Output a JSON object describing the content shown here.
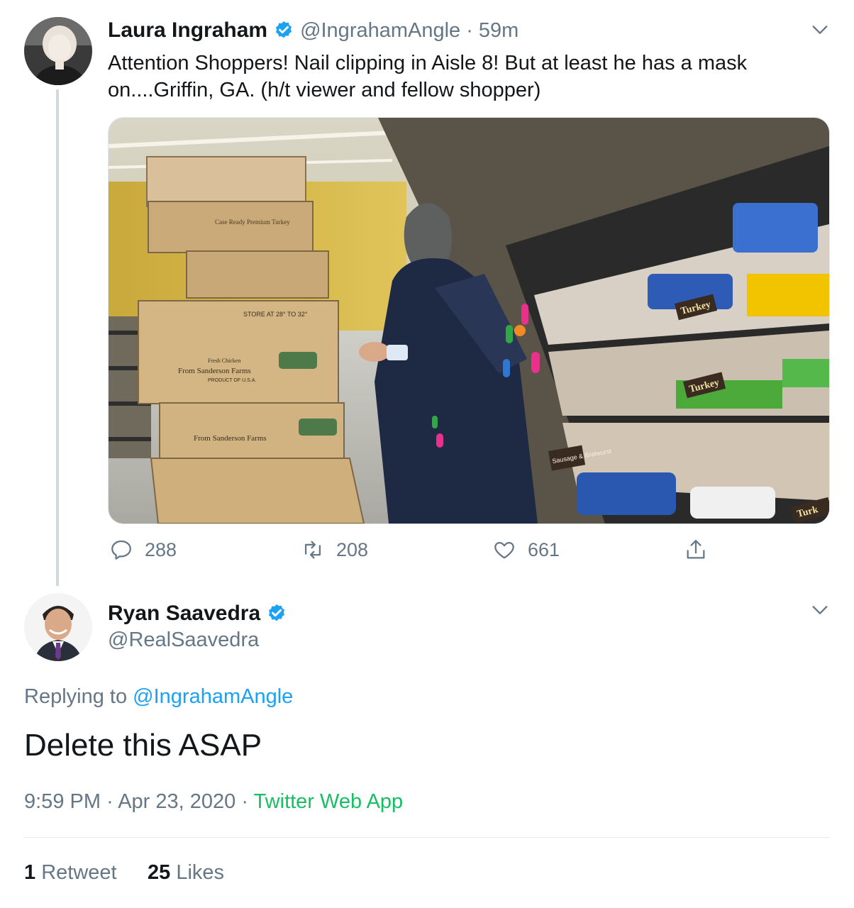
{
  "tweet": {
    "author_name": "Laura Ingraham",
    "handle": "@IngrahamAngle",
    "separator": "·",
    "time": "59m",
    "text_line1": "Attention Shoppers! Nail clipping in Aisle 8! But at least he has a mask",
    "text_line2": "on....Griffin, GA.  (h/t viewer and fellow shopper)",
    "media": {
      "box_line1": "STORE AT 28° TO 32°",
      "box_label": "Fresh Chicken",
      "box_brand": "From Sanderson Farms",
      "box_sub": "PRODUCT OF U.S.A.",
      "box_badge": "Sanderson Farms",
      "top_box": "Case Ready Premium Turkey",
      "shelf_label_1": "Turkey",
      "shelf_label_2": "Turkey",
      "shelf_label_3": "Turk",
      "shelf_sign": "Sausage & Bratwurst"
    },
    "actions": {
      "reply_count": "288",
      "retweet_count": "208",
      "like_count": "661"
    }
  },
  "reply": {
    "author_name": "Ryan Saavedra",
    "handle": "@RealSaavedra",
    "replying_prefix": "Replying to",
    "replying_handle": "@IngrahamAngle",
    "text": "Delete this ASAP",
    "time": "9:59 PM",
    "date": "Apr 23, 2020",
    "separator": "·",
    "source": "Twitter Web App",
    "retweet_count": "1",
    "retweet_label": "Retweet",
    "like_count": "25",
    "like_label": "Likes"
  },
  "colors": {
    "accent": "#1da1f2",
    "muted": "#657786",
    "source_green": "#17bf63",
    "verified": "#1da1f2"
  }
}
